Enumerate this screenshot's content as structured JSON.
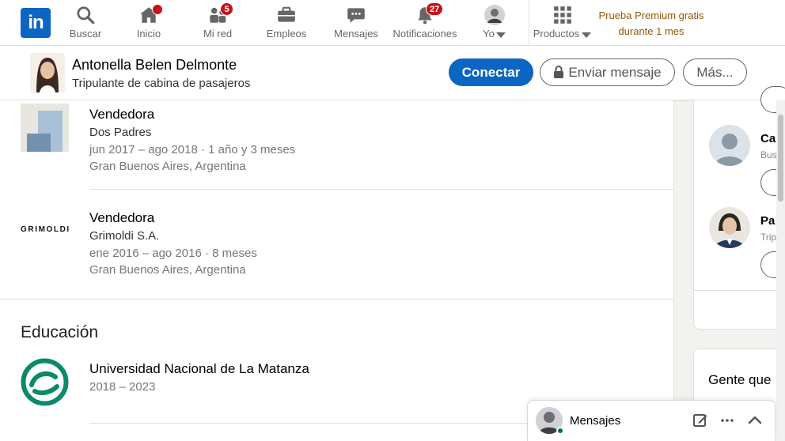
{
  "nav": {
    "logo_text": "in",
    "items": [
      {
        "label": "Buscar",
        "icon": "search-icon"
      },
      {
        "label": "Inicio",
        "icon": "home-icon",
        "badge": ""
      },
      {
        "label": "Mi red",
        "icon": "my-network-icon",
        "badge": "5"
      },
      {
        "label": "Empleos",
        "icon": "briefcase-icon"
      },
      {
        "label": "Mensajes",
        "icon": "messaging-icon"
      },
      {
        "label": "Notificaciones",
        "icon": "bell-icon",
        "badge": "27"
      },
      {
        "label": "Yo",
        "icon": "profile-avatar"
      },
      {
        "label": "Productos",
        "icon": "grid-icon"
      }
    ],
    "premium_line1": "Prueba Premium gratis",
    "premium_line2": "durante 1 mes"
  },
  "profile": {
    "name": "Antonella Belen Delmonte",
    "headline": "Tripulante de cabina de pasajeros",
    "connect_label": "Conectar",
    "message_label": "Enviar mensaje",
    "more_label": "Más..."
  },
  "experience": [
    {
      "title": "Vendedora",
      "company": "Dos Padres",
      "dates": "jun 2017 – ago 2018 · 1 año y 3 meses",
      "location": "Gran Buenos Aires, Argentina"
    },
    {
      "title": "Vendedora",
      "company": "Grimoldi S.A.",
      "company_logo_text": "GRIMOLDI",
      "dates": "ene 2016 – ago 2016 · 8 meses",
      "location": "Gran Buenos Aires, Argentina"
    }
  ],
  "education": {
    "heading": "Educación",
    "items": [
      {
        "school": "Universidad Nacional de La Matanza",
        "years": "2018 – 2023"
      }
    ]
  },
  "rail": {
    "people": [
      {
        "name": "Ca",
        "sub": "Bus"
      },
      {
        "name": "Pa",
        "sub": "Trip"
      }
    ],
    "card2_title": "Gente que"
  },
  "messaging": {
    "label": "Mensajes"
  },
  "colors": {
    "brand": "#0a66c2",
    "badge": "#cc1016",
    "premium": "#915907",
    "online": "#057642"
  }
}
